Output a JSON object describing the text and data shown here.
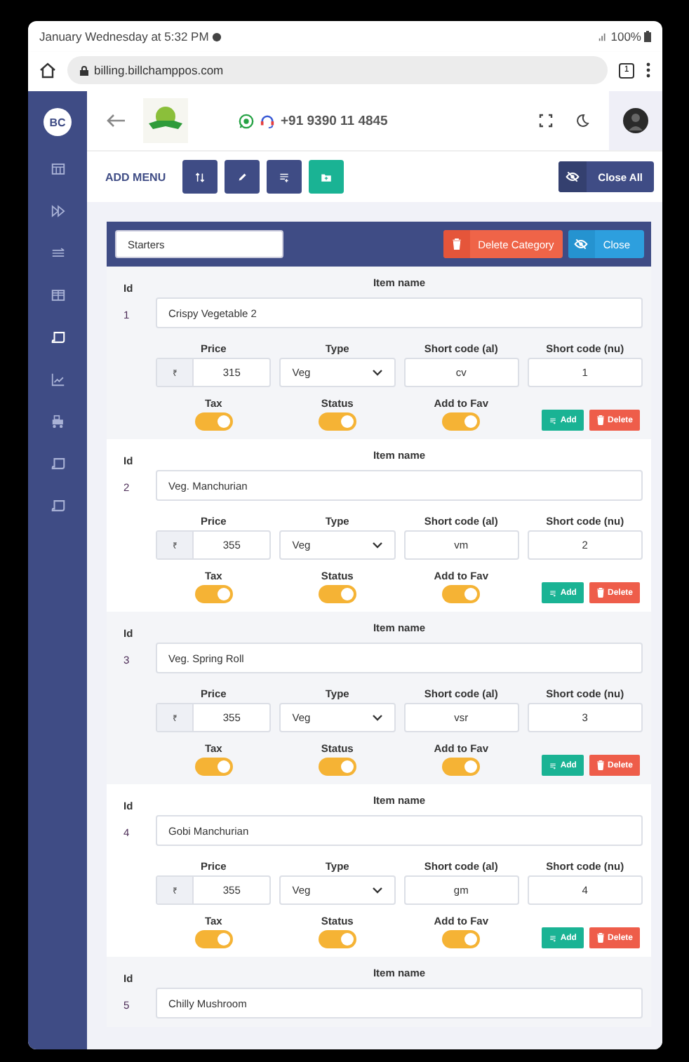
{
  "status_bar": {
    "time": "January Wednesday at 5:32 PM",
    "battery": "100%"
  },
  "browser": {
    "url": "billing.billchamppos.com",
    "tab_count": "1"
  },
  "sidebar": {
    "avatar": "BC",
    "items": [
      {
        "kind": "calendar",
        "selected": false
      },
      {
        "kind": "forward",
        "selected": false
      },
      {
        "kind": "lines",
        "selected": false
      },
      {
        "kind": "table",
        "selected": false
      },
      {
        "kind": "receipt",
        "selected": true
      },
      {
        "kind": "chart",
        "selected": false
      },
      {
        "kind": "cart",
        "selected": false
      },
      {
        "kind": "receipt",
        "selected": false
      },
      {
        "kind": "receipt",
        "selected": false
      }
    ]
  },
  "header": {
    "phone": "+91 9390 11 4845"
  },
  "toolbar": {
    "title": "ADD MENU",
    "buttons": [
      {
        "kind": "sort",
        "color": "#3f4c85"
      },
      {
        "kind": "edit",
        "color": "#3f4c85"
      },
      {
        "kind": "list",
        "color": "#3f4c85"
      },
      {
        "kind": "folder",
        "color": "#1ab394"
      }
    ],
    "close_all": "Close All"
  },
  "category": {
    "name": "Starters",
    "delete": "Delete Category",
    "close": "Close"
  },
  "items": [
    {
      "id_label": "Id",
      "id": "1",
      "name_label": "Item name",
      "name": "Crispy Vegetable 2",
      "price_label": "Price",
      "currency": "₹",
      "price": "315",
      "type_label": "Type",
      "type": "Veg",
      "code_al_label": "Short code (al)",
      "code_al": "cv",
      "code_nu_label": "Short code (nu)",
      "code_nu": "1",
      "toggles": [
        {
          "label": "Tax",
          "on": true
        },
        {
          "label": "Status",
          "on": true
        },
        {
          "label": "Add to Fav",
          "on": true
        }
      ],
      "add": "Add",
      "delete": "Delete"
    },
    {
      "id_label": "Id",
      "id": "2",
      "name_label": "Item name",
      "name": "Veg. Manchurian",
      "price_label": "Price",
      "currency": "₹",
      "price": "355",
      "type_label": "Type",
      "type": "Veg",
      "code_al_label": "Short code (al)",
      "code_al": "vm",
      "code_nu_label": "Short code (nu)",
      "code_nu": "2",
      "toggles": [
        {
          "label": "Tax",
          "on": true
        },
        {
          "label": "Status",
          "on": true
        },
        {
          "label": "Add to Fav",
          "on": true
        }
      ],
      "add": "Add",
      "delete": "Delete"
    },
    {
      "id_label": "Id",
      "id": "3",
      "name_label": "Item name",
      "name": "Veg. Spring Roll",
      "price_label": "Price",
      "currency": "₹",
      "price": "355",
      "type_label": "Type",
      "type": "Veg",
      "code_al_label": "Short code (al)",
      "code_al": "vsr",
      "code_nu_label": "Short code (nu)",
      "code_nu": "3",
      "toggles": [
        {
          "label": "Tax",
          "on": true
        },
        {
          "label": "Status",
          "on": true
        },
        {
          "label": "Add to Fav",
          "on": true
        }
      ],
      "add": "Add",
      "delete": "Delete"
    },
    {
      "id_label": "Id",
      "id": "4",
      "name_label": "Item name",
      "name": "Gobi Manchurian",
      "price_label": "Price",
      "currency": "₹",
      "price": "355",
      "type_label": "Type",
      "type": "Veg",
      "code_al_label": "Short code (al)",
      "code_al": "gm",
      "code_nu_label": "Short code (nu)",
      "code_nu": "4",
      "toggles": [
        {
          "label": "Tax",
          "on": true
        },
        {
          "label": "Status",
          "on": true
        },
        {
          "label": "Add to Fav",
          "on": true
        }
      ],
      "add": "Add",
      "delete": "Delete"
    },
    {
      "id_label": "Id",
      "id": "5",
      "name_label": "Item name",
      "name": "Chilly Mushroom"
    }
  ]
}
